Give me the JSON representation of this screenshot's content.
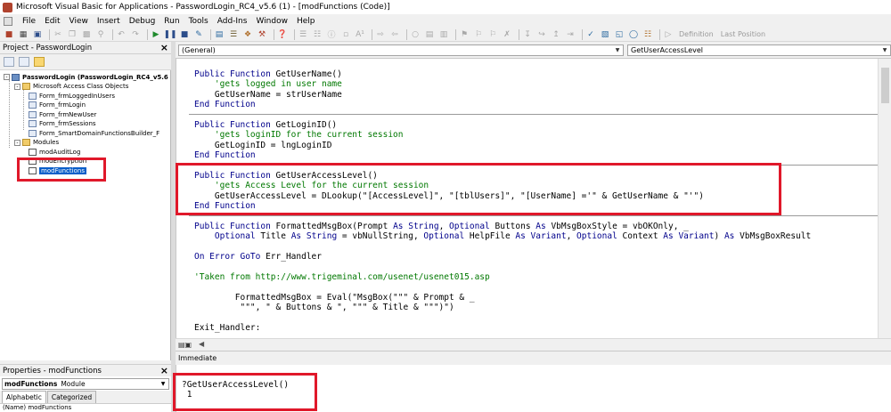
{
  "window": {
    "title": "Microsoft Visual Basic for Applications - PasswordLogin_RC4_v5.6 (1) - [modFunctions (Code)]"
  },
  "menu": [
    "File",
    "Edit",
    "View",
    "Insert",
    "Debug",
    "Run",
    "Tools",
    "Add-Ins",
    "Window",
    "Help"
  ],
  "toolbar": {
    "definition_label": "Definition",
    "last_position_label": "Last Position"
  },
  "project_panel": {
    "title": "Project - PasswordLogin",
    "tree": [
      {
        "label": "PasswordLogin (PasswordLogin_RC4_v5.6 (1))",
        "level": 0,
        "icon": "project-icon",
        "expander": "-",
        "bold": true
      },
      {
        "label": "Microsoft Access Class Objects",
        "level": 1,
        "icon": "folder-icon",
        "expander": "-"
      },
      {
        "label": "Form_frmLoggedInUsers",
        "level": 2,
        "icon": "form-icon"
      },
      {
        "label": "Form_frmLogin",
        "level": 2,
        "icon": "form-icon"
      },
      {
        "label": "Form_frmNewUser",
        "level": 2,
        "icon": "form-icon"
      },
      {
        "label": "Form_frmSessions",
        "level": 2,
        "icon": "form-icon"
      },
      {
        "label": "Form_SmartDomainFunctionsBuilder_F",
        "level": 2,
        "icon": "form-icon"
      },
      {
        "label": "Modules",
        "level": 1,
        "icon": "folder-icon",
        "expander": "-"
      },
      {
        "label": "modAuditLog",
        "level": 2,
        "icon": "module-icon"
      },
      {
        "label": "modEncryption",
        "level": 2,
        "icon": "module-icon"
      },
      {
        "label": "modFunctions",
        "level": 2,
        "icon": "module-icon",
        "selected": true
      }
    ]
  },
  "properties_panel": {
    "title": "Properties - modFunctions",
    "object_name": "modFunctions",
    "object_type": "Module",
    "tabs": [
      "Alphabetic",
      "Categorized"
    ],
    "row": "(Name) modFunctions"
  },
  "code_window": {
    "object_combo": "(General)",
    "procedure_combo": "GetUserAccessLevel",
    "lines": [
      {
        "segments": [
          {
            "t": "Public Function ",
            "c": "kw"
          },
          {
            "t": "GetUserName()",
            "c": ""
          }
        ]
      },
      {
        "segments": [
          {
            "t": "    'gets logged in user name",
            "c": "cm"
          }
        ]
      },
      {
        "segments": [
          {
            "t": "    GetUserName = strUserName",
            "c": ""
          }
        ]
      },
      {
        "segments": [
          {
            "t": "End Function",
            "c": "kw"
          }
        ],
        "sep_after": true
      },
      {
        "segments": [
          {
            "t": "",
            "c": ""
          }
        ]
      },
      {
        "segments": [
          {
            "t": "Public Function ",
            "c": "kw"
          },
          {
            "t": "GetLoginID()",
            "c": ""
          }
        ]
      },
      {
        "segments": [
          {
            "t": "    'gets loginID for the current session",
            "c": "cm"
          }
        ]
      },
      {
        "segments": [
          {
            "t": "    GetLoginID = lngLoginID",
            "c": ""
          }
        ]
      },
      {
        "segments": [
          {
            "t": "End Function",
            "c": "kw"
          }
        ],
        "sep_after": true
      },
      {
        "segments": [
          {
            "t": "",
            "c": ""
          }
        ]
      },
      {
        "segments": [
          {
            "t": "Public Function ",
            "c": "kw"
          },
          {
            "t": "GetUserAccessLevel()",
            "c": ""
          }
        ]
      },
      {
        "segments": [
          {
            "t": "    'gets Access Level for the current session",
            "c": "cm"
          }
        ]
      },
      {
        "segments": [
          {
            "t": "    GetUserAccessLevel = DLookup(\"[AccessLevel]\", \"[tblUsers]\", \"[UserName] ='\" & GetUserName & \"'\")",
            "c": ""
          }
        ]
      },
      {
        "segments": [
          {
            "t": "End Function",
            "c": "kw"
          }
        ],
        "sep_after": true
      },
      {
        "segments": [
          {
            "t": "",
            "c": ""
          }
        ]
      },
      {
        "segments": [
          {
            "t": "Public Function ",
            "c": "kw"
          },
          {
            "t": "FormattedMsgBox(Prompt ",
            "c": ""
          },
          {
            "t": "As String",
            "c": "kw"
          },
          {
            "t": ", ",
            "c": ""
          },
          {
            "t": "Optional",
            "c": "kw"
          },
          {
            "t": " Buttons ",
            "c": ""
          },
          {
            "t": "As",
            "c": "kw"
          },
          {
            "t": " VbMsgBoxStyle = vbOKOnly, _",
            "c": ""
          }
        ]
      },
      {
        "segments": [
          {
            "t": "    ",
            "c": ""
          },
          {
            "t": "Optional",
            "c": "kw"
          },
          {
            "t": " Title ",
            "c": ""
          },
          {
            "t": "As String",
            "c": "kw"
          },
          {
            "t": " = vbNullString, ",
            "c": ""
          },
          {
            "t": "Optional",
            "c": "kw"
          },
          {
            "t": " HelpFile ",
            "c": ""
          },
          {
            "t": "As Variant",
            "c": "kw"
          },
          {
            "t": ", ",
            "c": ""
          },
          {
            "t": "Optional",
            "c": "kw"
          },
          {
            "t": " Context ",
            "c": ""
          },
          {
            "t": "As Variant",
            "c": "kw"
          },
          {
            "t": ") ",
            "c": ""
          },
          {
            "t": "As",
            "c": "kw"
          },
          {
            "t": " VbMsgBoxResult",
            "c": ""
          }
        ]
      },
      {
        "segments": [
          {
            "t": "",
            "c": ""
          }
        ]
      },
      {
        "segments": [
          {
            "t": "On Error GoTo",
            "c": "kw"
          },
          {
            "t": " Err_Handler",
            "c": ""
          }
        ]
      },
      {
        "segments": [
          {
            "t": "",
            "c": ""
          }
        ]
      },
      {
        "segments": [
          {
            "t": "'Taken from http://www.trigeminal.com/usenet/usenet015.asp",
            "c": "cm"
          }
        ]
      },
      {
        "segments": [
          {
            "t": "",
            "c": ""
          }
        ]
      },
      {
        "segments": [
          {
            "t": "        FormattedMsgBox = Eval(\"MsgBox(\"\"\" & Prompt & _",
            "c": ""
          }
        ]
      },
      {
        "segments": [
          {
            "t": "         \"\"\", \" & Buttons & \", \"\"\" & Title & \"\"\")\")",
            "c": ""
          }
        ]
      },
      {
        "segments": [
          {
            "t": "",
            "c": ""
          }
        ]
      },
      {
        "segments": [
          {
            "t": "Exit_Handler:",
            "c": ""
          }
        ]
      }
    ]
  },
  "immediate_window": {
    "title": "Immediate",
    "lines": [
      "?GetUserAccessLevel()",
      " 1"
    ]
  }
}
